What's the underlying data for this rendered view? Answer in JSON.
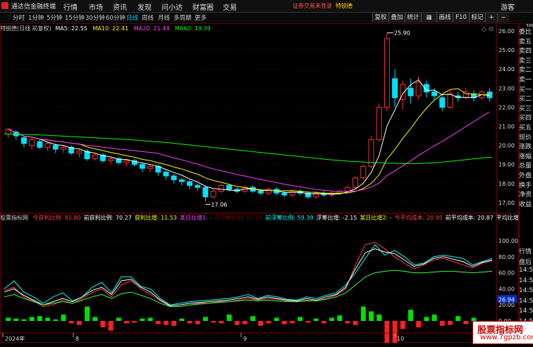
{
  "titlebar": {
    "app_name": "通达信金融终端",
    "menus": [
      "行情",
      "市场",
      "资讯",
      "发现",
      "问小达",
      "财富圈",
      "交易"
    ],
    "warning": "证券交易未登录",
    "stock_name": "特锐德",
    "guest": "游客"
  },
  "toolbar": {
    "periods": [
      "分时",
      "1分钟",
      "5分钟",
      "15分钟",
      "30分钟",
      "60分钟",
      "日线",
      "周线",
      "月线",
      "多周期",
      "更多"
    ],
    "active_period": "日线",
    "right_buttons": [
      "复权",
      "叠加",
      "统计",
      "画线",
      "F10",
      "标记"
    ]
  },
  "main_header": {
    "title": "特锐德(日线 前复权)",
    "ma": [
      {
        "label": "MA5: 22.55",
        "color": "#ffffff"
      },
      {
        "label": "MA10: 22.41",
        "color": "#ffff00"
      },
      {
        "label": "MA20: 21.44",
        "color": "#ff40ff"
      },
      {
        "label": "MA60: 19.39",
        "color": "#00ff00"
      }
    ]
  },
  "sub_header": {
    "title": "股票指标网",
    "items": [
      {
        "label": "今获利比例: 81.80",
        "color": "#ff4040"
      },
      {
        "label": "前获利比例: 70.27",
        "color": "#ffffff"
      },
      {
        "label": "获利比增: 11.53",
        "color": "#ffff00"
      },
      {
        "label": "某日比增1: -",
        "color": "#ff40ff"
      },
      {
        "label": "今浮筹比例: 57.26",
        "color": "#800000"
      },
      {
        "label": "前浮筹比例: 59.39",
        "color": "#00ffff"
      },
      {
        "label": "浮筹比增: -2.15",
        "color": "#ffffff"
      },
      {
        "label": "某日比增2: -",
        "color": "#ffff00"
      },
      {
        "label": "今平均成本: 20.95",
        "color": "#ff4040"
      },
      {
        "label": "前平均成本: 20.87",
        "color": "#ffffff"
      },
      {
        "label": "平均比增",
        "color": "#ffffff"
      }
    ]
  },
  "price_axis": [
    "26.00",
    "25.00",
    "24.00",
    "23.00",
    "22.00",
    "21.00",
    "20.00",
    "19.00",
    "18.00",
    "17.00"
  ],
  "indicator_axis": [
    "100.00",
    "80.00",
    "60.00",
    "40.00",
    "20.00",
    "0.00"
  ],
  "price_marks": {
    "high": "25.90",
    "low": "17.06"
  },
  "current_value_tag": "26.94",
  "side_panel": [
    "委比",
    "卖五",
    "卖四",
    "卖三",
    "卖二",
    "卖一",
    "买一",
    "买二",
    "买三",
    "买四",
    "买五",
    "现价",
    "涨跌",
    "涨幅",
    "总量",
    "外盘",
    "换手",
    "净资",
    "收益"
  ],
  "side_panel_lower": [
    "行情",
    "盘后",
    "14:50",
    "14:50",
    "14:50",
    "14:50",
    "14:50",
    "14:50",
    "14:50",
    "14:50"
  ],
  "side_top": "500",
  "date_axis": [
    "2024年",
    "8",
    "9",
    "10"
  ],
  "watermark": {
    "line1": "股票指标网",
    "line2": "www.7gpzb.com"
  },
  "colors": {
    "up": "#ff3030",
    "down": "#00e0ff",
    "ma5": "#ffffff",
    "ma10": "#ffff00",
    "ma20": "#ff40ff",
    "ma60": "#00ff00",
    "grid": "#5a0000"
  }
}
